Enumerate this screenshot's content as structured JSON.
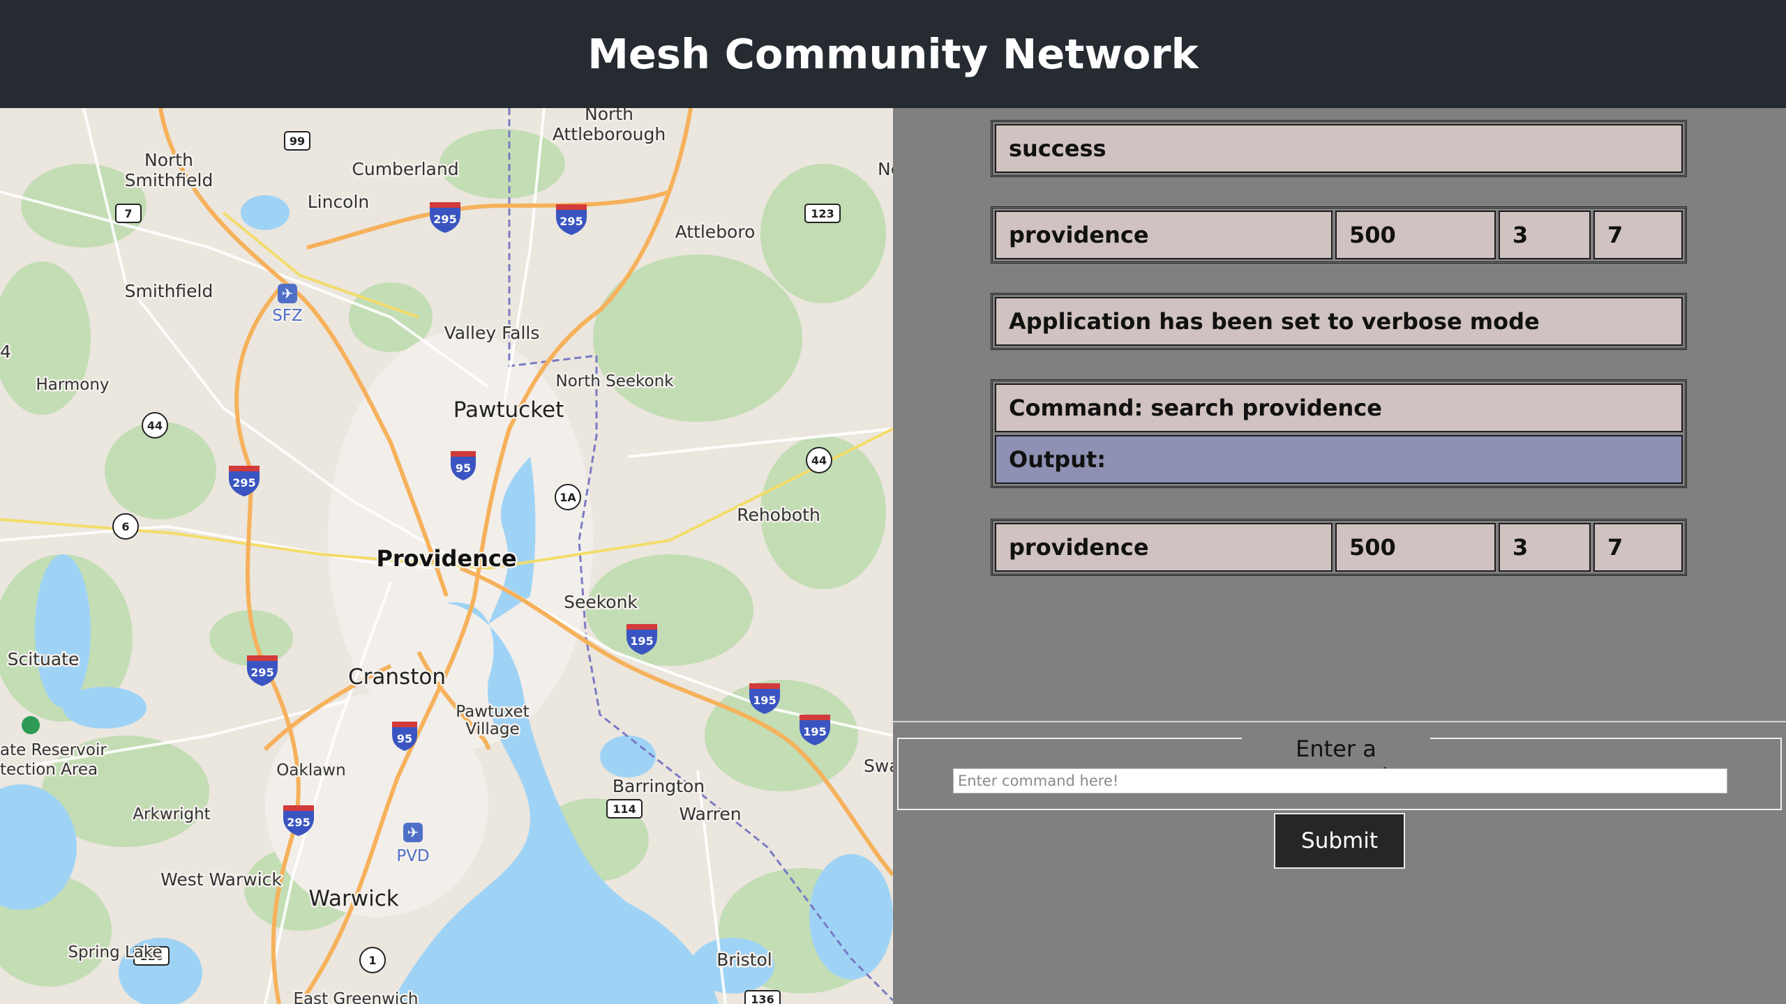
{
  "header": {
    "title": "Mesh Community Network"
  },
  "map": {
    "labels": {
      "north_attleborough_1": "North",
      "north_attleborough_2": "Attleborough",
      "north_smithfield_1": "North",
      "north_smithfield_2": "Smithfield",
      "cumberland": "Cumberland",
      "lincoln": "Lincoln",
      "attleboro": "Attleboro",
      "smithfield": "Smithfield",
      "sfz": "SFZ",
      "valley_falls": "Valley Falls",
      "north_seekonk": "North Seekonk",
      "harmony": "Harmony",
      "pawtucket": "Pawtucket",
      "rehoboth": "Rehoboth",
      "providence": "Providence",
      "seekonk": "Seekonk",
      "scituate": "Scituate",
      "cranston": "Cranston",
      "pawtuxet_1": "Pawtuxet",
      "pawtuxet_2": "Village",
      "reservoir_1": "ate Reservoir",
      "reservoir_2": "tection Area",
      "oaklawn": "Oaklawn",
      "barrington": "Barrington",
      "warren": "Warren",
      "arkwright": "Arkwright",
      "pvd": "PVD",
      "west_warwick": "West Warwick",
      "warwick": "Warwick",
      "spring_lake": "Spring Lake",
      "bristol": "Bristol",
      "east_greenwich": "East Greenwich",
      "edge_ne": "Ne",
      "edge_swa": "Swa",
      "edge_4": "4"
    },
    "shields": {
      "r99": "99",
      "r7": "7",
      "r123": "123",
      "r295": "295",
      "r44": "44",
      "r95": "95",
      "r1a": "1A",
      "r6": "6",
      "r195": "195",
      "r114": "114",
      "r116": "116",
      "r1": "1",
      "r136": "136"
    }
  },
  "results": {
    "status": "success",
    "row1": {
      "name": "providence",
      "a": "500",
      "b": "3",
      "c": "7"
    },
    "message": "Application has been set to verbose mode",
    "command": "Command: search providence",
    "output": "Output:",
    "row2": {
      "name": "providence",
      "a": "500",
      "b": "3",
      "c": "7"
    }
  },
  "command_form": {
    "legend": "Enter a command:",
    "placeholder": "Enter command here!",
    "value": "",
    "submit_label": "Submit"
  },
  "colors": {
    "header_bg": "#262a31",
    "panel_bg": "#808080",
    "cell_bg": "#d0c2c0",
    "output_bg": "#8e91b3",
    "water": "#9fd3f6",
    "highway": "#f6b15b"
  }
}
